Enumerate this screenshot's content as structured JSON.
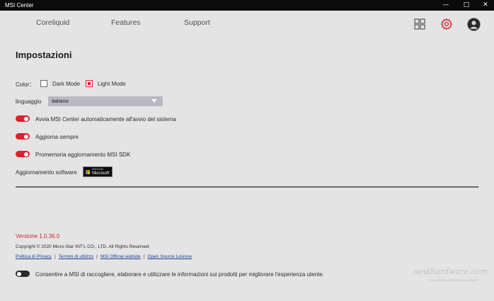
{
  "window": {
    "title": "MSI Center",
    "controls": {
      "minimize": "—",
      "maximize": "□",
      "close": "✕"
    }
  },
  "nav": {
    "tabs": [
      {
        "label": "Coreliquid"
      },
      {
        "label": "Features"
      },
      {
        "label": "Support"
      }
    ],
    "icons": [
      "grid-icon",
      "settings-gear-icon",
      "user-avatar-icon"
    ],
    "active_icon_color": "#e0202b"
  },
  "settings": {
    "title": "Impostazioni",
    "color": {
      "label": "Color：",
      "options": [
        {
          "label": "Dark Mode",
          "checked": false
        },
        {
          "label": "Light Mode",
          "checked": true
        }
      ]
    },
    "language": {
      "label": "linguaggio",
      "value": "italiano"
    },
    "toggles": [
      {
        "label": "Avvia MSI Center automaticamente all'avvio del sistema",
        "on": true
      },
      {
        "label": "Aggiorna sempre",
        "on": true
      },
      {
        "label": "Promemoria aggiornamento MSI SDK",
        "on": true
      }
    ],
    "software_update": {
      "label": "Aggiornamento software",
      "badge_small": "Get it from",
      "badge_big": "Microsoft"
    }
  },
  "footer": {
    "version": "Versione 1.0.36.0",
    "copyright": "Copyright © 2020 Micro-Star INT'L CO., LTD. All Rights Reserved",
    "links": [
      {
        "label": "Politica di Privacy"
      },
      {
        "label": "Termini di utilizzo"
      },
      {
        "label": "MSI Official website"
      },
      {
        "label": "Open Source License"
      }
    ],
    "consent": {
      "label": "Consentire a MSI di raccogliere, elaborare e utilizzare le informazioni sui prodotti per migliorare l'esperienza utente.",
      "on": false
    }
  },
  "watermark": {
    "brand": "nexthardware.com",
    "tagline": "your ultimate professional resource"
  },
  "colors": {
    "accent": "#e0202b",
    "background": "#e4e4e4",
    "titlebar": "#0b0b0b",
    "link": "#1d3f9c"
  }
}
